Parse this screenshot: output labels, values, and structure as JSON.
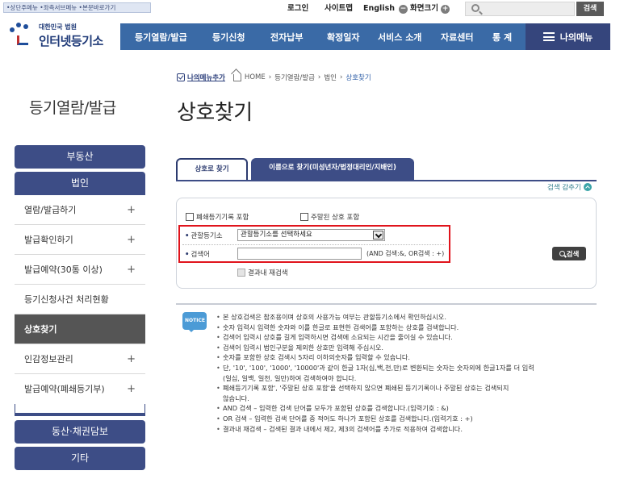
{
  "utility": {
    "skip_links": "•상단주메뉴 •좌측서브메뉴 •본문바로가기",
    "login": "로그인",
    "sitemap": "사이트맵",
    "english": "English",
    "screen_minus": "−",
    "screen_size": "화면크기",
    "screen_plus": "+",
    "search_button": "검색"
  },
  "logo": {
    "sub": "대한민국 법원",
    "main": "인터넷등기소"
  },
  "nav": {
    "items": [
      "등기열람/발급",
      "등기신청",
      "전자납부",
      "확정일자",
      "서비스 소개",
      "자료센터",
      "통 계"
    ],
    "my_menu": "나의메뉴"
  },
  "breadcrumb": {
    "my_menu_add": "나의메뉴추가",
    "home": "HOME",
    "path": [
      "등기열람/발급",
      "법인",
      "상호찾기"
    ]
  },
  "sidebar": {
    "title": "등기열람/발급",
    "top_buttons": [
      "부동산",
      "법인"
    ],
    "items": [
      {
        "label": "열람/발급하기",
        "plus": "+"
      },
      {
        "label": "발급확인하기",
        "plus": "+"
      },
      {
        "label": "발급예약(30통 이상)",
        "plus": "+"
      },
      {
        "label": "등기신청사건 처리현황",
        "plus": ""
      },
      {
        "label": "상호찾기",
        "plus": ""
      },
      {
        "label": "인감정보관리",
        "plus": "+"
      },
      {
        "label": "발급예약(폐쇄등기부)",
        "plus": "+"
      }
    ],
    "bottom_buttons": [
      "동산·채권담보",
      "기타"
    ]
  },
  "main": {
    "title": "상호찾기",
    "tabs": [
      "상호로 찾기",
      "이름으로 찾기(미성년자/법정대리인/지배인)"
    ],
    "collapse": "검색 감추기"
  },
  "form": {
    "closed_registry": "폐쇄등기기록 포함",
    "dormant": "주말된 상호 포함",
    "registry_label": "관할등기소",
    "registry_value": "관할등기소를 선택하세요",
    "keyword_label": "검색어",
    "keyword_value": "",
    "hint": "(AND 검색:&, OR검색 : +)",
    "search_button": "검색",
    "research": "결과내 재검색"
  },
  "notice": {
    "icon_label": "NOTICE",
    "lines": [
      {
        "text": "본 상호검색은 참조용이며 상호의 사용가능 여부는 관할등기소에서 확인하십시오.",
        "bullet": true
      },
      {
        "text": "숫자 입력시 입력한 숫자와 이를 한글로 표현한 검색어를 포함하는 상호를 검색합니다.",
        "bullet": true
      },
      {
        "text": "검색어 입력시 상호를 길게 입력하시면 검색에 소요되는 시간을 줄이실 수 있습니다.",
        "bullet": true
      },
      {
        "text": "검색어 입력시 법인구분을 제외한 상호만 입력해 주십시오.",
        "bullet": true
      },
      {
        "text": "숫자를 포함한 상호 검색시 5자리 이하의숫자를 입력할 수 있습니다.",
        "bullet": true
      },
      {
        "text": "단, '10', '100', '1000', '10000'과 같이 한글 1자(십,백,천,만)로 변환되는 숫자는 숫자외에 한글1자를 더 입력",
        "bullet": true
      },
      {
        "text": "(일십, 일백, 일천, 일만)하여 검색하여야 합니다.",
        "bullet": false
      },
      {
        "text": "폐쇄등기기록 포함', '주말된 상호 포함'을 선택하지 않으면 폐쇄된 등기기록이나 주말된 상호는 검색되지",
        "bullet": true
      },
      {
        "text": "않습니다.",
        "bullet": false
      },
      {
        "text": "AND 검색 – 입력한 검색 단어를 모두가 포함된 상호를 검색합니다.(입력기호 : &)",
        "bullet": true
      },
      {
        "text": "OR 검색 – 입력한 검색 단어를 중 적어도 하나가 포함된 상호를 검색합니다.(입력기호 : +)",
        "bullet": true
      },
      {
        "text": "결과내 재검색 – 검색된 결과 내에서 제2, 제3의 검색어를 추가로 적용하여 검색합니다.",
        "bullet": true
      }
    ]
  },
  "colors": {
    "nav": "#3a6aa6",
    "sidebar_dark": "#3d4d86",
    "highlight": "#e0141c"
  }
}
